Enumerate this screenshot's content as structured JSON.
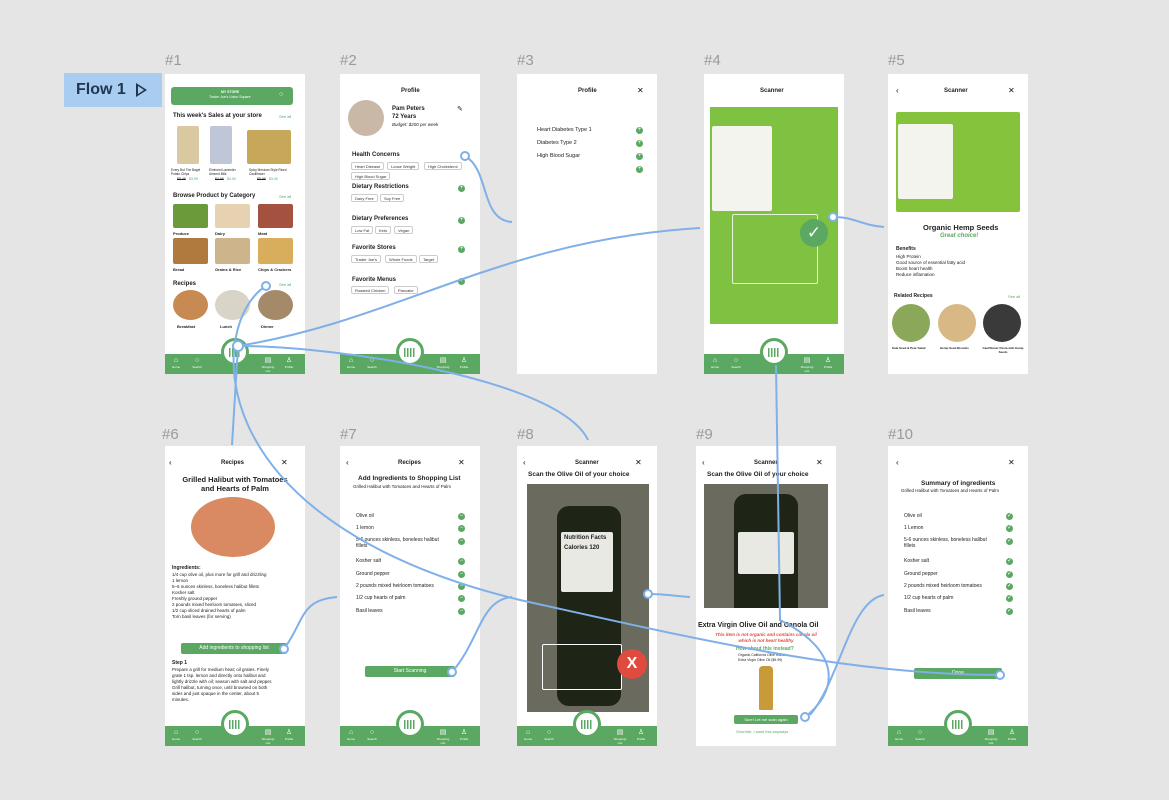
{
  "flow": {
    "label": "Flow 1"
  },
  "frame_labels": [
    "#1",
    "#2",
    "#3",
    "#4",
    "#5",
    "#6",
    "#7",
    "#8",
    "#9",
    "#10"
  ],
  "nav": {
    "home": "Home",
    "search": "Search",
    "list": "Shopping List",
    "profile": "Profile"
  },
  "f1": {
    "store_label": "MY STORE",
    "store_name": "Trader Joe's Union Square",
    "sales_title": "This week's Sales at your store",
    "see_all": "See all",
    "sales": [
      {
        "name": "Every But The Bagel Potato Chips",
        "old": "$5.49",
        "new": "$3.99"
      },
      {
        "name": "Elmhurst Lavender Almond Milk",
        "old": "$4.99",
        "new": "$4.00"
      },
      {
        "name": "Spicy Mexican Style Riced Cauliflower",
        "old": "$5.99",
        "new": "$3.49"
      }
    ],
    "browse_title": "Browse Product by Category",
    "categories": [
      "Produce",
      "Dairy",
      "Meat",
      "Bread",
      "Grains & Rice",
      "Chips & Crackers"
    ],
    "recipes_title": "Recipes",
    "recipes": [
      "Breakfast",
      "Lunch",
      "Dinner"
    ]
  },
  "f2": {
    "title": "Profile",
    "name": "Pam Peters",
    "age": "72 Years",
    "budget": "Budget: $200 per week",
    "health_title": "Health Concerns",
    "health": [
      "Heart Disease",
      "Loose Weight",
      "High Cholesterol",
      "High Blood Sugar"
    ],
    "restrictions_title": "Dietary Restrictions",
    "restrictions": [
      "Dairy Free",
      "Soy Free"
    ],
    "preferences_title": "Dietary Preferences",
    "preferences": [
      "Low Fat",
      "Keto",
      "Vegan"
    ],
    "stores_title": "Favorite Stores",
    "stores": [
      "Trader Joe's",
      "Whole Foods",
      "Target"
    ],
    "menus_title": "Favorite Menus",
    "menus": [
      "Roasted Chicken",
      "Pancake"
    ]
  },
  "f3": {
    "title": "Profile",
    "items": [
      "Heart Diabetes Type 1",
      "Diabetes Type 2",
      "High Blood Sugar"
    ]
  },
  "f4": {
    "title": "Scanner"
  },
  "f5": {
    "title": "Scanner",
    "product": "Organic Hemp Seeds",
    "verdict": "Great choice!",
    "benefits_title": "Benefits",
    "benefits": [
      "High Protein",
      "Good source of essential fatty acid",
      "Boost heart health",
      "Reduce inflamation"
    ],
    "related_title": "Related Recipes",
    "see_all": "See all",
    "recipes": [
      "Kale Seed & Pear Salad",
      "Hemp Seed Biscuits",
      "Cauliflower Pasta with Hemp Seeds"
    ]
  },
  "f6": {
    "title": "Recipes",
    "recipe": "Grilled Halibut with Tomatoes and Hearts of Palm",
    "ing_title": "Ingredients:",
    "ingredients": [
      "1/4  cup olive oil, plus more for grill and drizzling",
      "1  lemon",
      "5–6 ounces skinless, boneless halibut fillets",
      "Kosher salt",
      "Freshly ground pepper",
      "2 pounds mixed heirloom tomatoes, sliced",
      "1/2 cup sliced drained hearts of palm",
      "Torn basil leaves (for serving)"
    ],
    "button": "Add ingredients to shopping list",
    "step_title": "Step 1",
    "step": [
      "Prepare a grill for medium heat; oil grates. Finely",
      "grate 1 tsp. lemon and directly onto halibut and",
      "lightly drizzle with oil; season with salt and pepper.",
      "Grill halibut, turning once, until browned on both",
      "sides and just opaque in the center, about 5",
      "minutes."
    ]
  },
  "f7": {
    "title": "Recipes",
    "heading": "Add Ingredients to Shopping List",
    "sub": "Grilled Halibut with Tomatoes and Hearts of Palm",
    "items": [
      "Olive oil",
      "1 lemon",
      "5-6 ounces skinless, boneless halibut fillets",
      "Kosher salt",
      "Ground pepper",
      "2 pounds mixed heirloom tomatoes",
      "1/2 cup hearts of palm",
      "Basil leaves"
    ],
    "button": "Start Scanning"
  },
  "f8": {
    "title": "Scanner",
    "heading": "Scan the Olive Oil of your choice",
    "label_head": "Nutrition Facts",
    "calories": "Calories 120"
  },
  "f9": {
    "title": "Scanner",
    "heading": "Scan the Olive Oil of your choice",
    "product": "Extra Virgin Olive Oil and Canola Oil",
    "warning": "This item is not organic and contains canola oil which is not heart healthy",
    "suggest": "How about this instead?",
    "alt1": "Organic California Olive Ranch",
    "alt2": "Extra Virgin Olive Oil ($9.99)",
    "button": "Sure! Let me scan again",
    "override": "Override, I want this anyways"
  },
  "f10": {
    "title": "Summary of ingredients",
    "sub": "Grilled Halibut with Tomatoes and Hearts of Palm",
    "items": [
      "Olive oil",
      "1 Lemon",
      "5-6 ounces skinless, boneless halibut fillets",
      "Kosher salt",
      "Ground pepper",
      "2 pounds mixed heirloom tomatoes",
      "1/2 cup hearts of palm",
      "Basil leaves"
    ],
    "button": "Done"
  },
  "colors": {
    "green": "#5aa862",
    "flow_blue": "#a9cdf0",
    "connector": "#7fb0e8",
    "alert": "#e04b3f"
  }
}
